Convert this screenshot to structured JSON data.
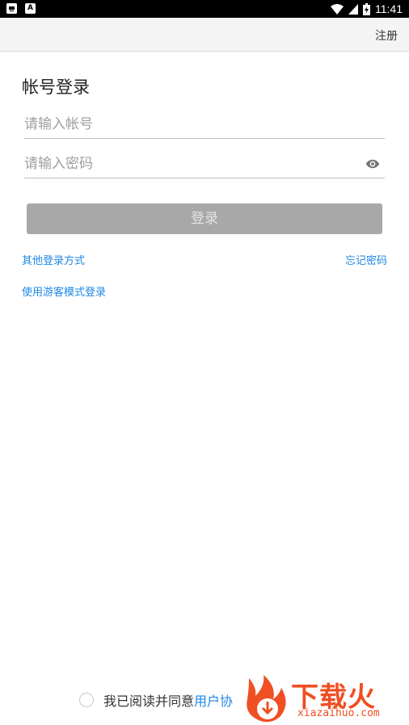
{
  "status_bar": {
    "time": "11:41",
    "left_icons": [
      "app-notification-icon",
      "font-app-icon"
    ],
    "font_app_letter": "A",
    "right_icons": [
      "wifi-icon",
      "signal-icon",
      "battery-icon"
    ]
  },
  "top_bar": {
    "register_label": "注册"
  },
  "login": {
    "title": "帐号登录",
    "account_placeholder": "请输入帐号",
    "account_value": "",
    "password_placeholder": "请输入密码",
    "password_value": "",
    "login_button_label": "登录",
    "other_login_label": "其他登录方式",
    "forgot_password_label": "忘记密码",
    "guest_login_label": "使用游客模式登录"
  },
  "agreement": {
    "text": "我已阅读并同意",
    "link_text": "用户协",
    "checked": false
  },
  "watermark": {
    "brand": "下载火",
    "site": "xiazaihuo.com"
  },
  "colors": {
    "accent": "#1e88e5",
    "button_disabled": "#a8a8a8",
    "top_bar": "#f4f4f4",
    "watermark": "#f04e23"
  }
}
